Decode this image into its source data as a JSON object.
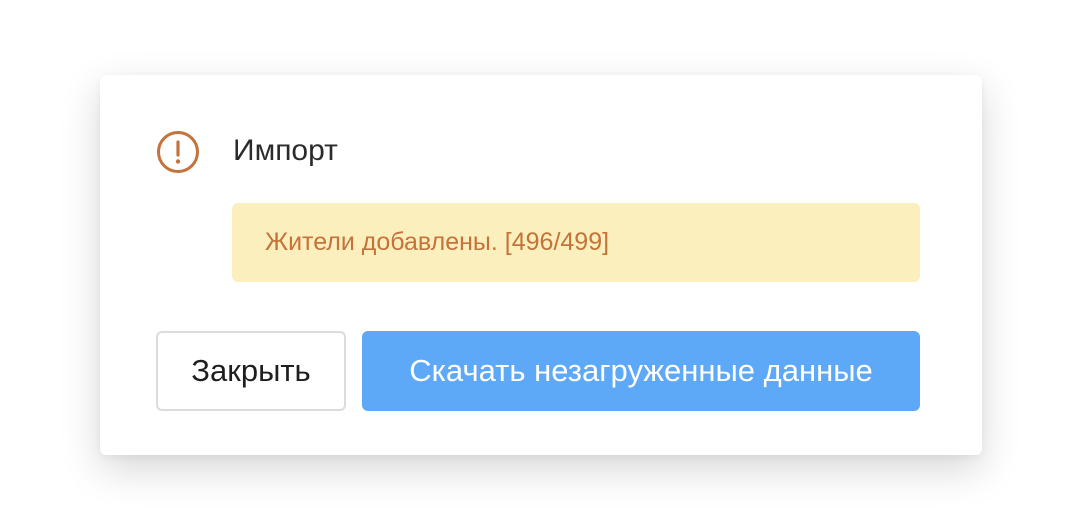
{
  "dialog": {
    "title": "Импорт",
    "icon": "warning-circle-icon",
    "message": "Жители добавлены. [496/499]",
    "close_label": "Закрыть",
    "download_label": "Скачать незагруженные данные"
  },
  "colors": {
    "warning_accent": "#c4733a",
    "alert_background": "#fcefbe",
    "primary_button": "#5da8f7"
  }
}
